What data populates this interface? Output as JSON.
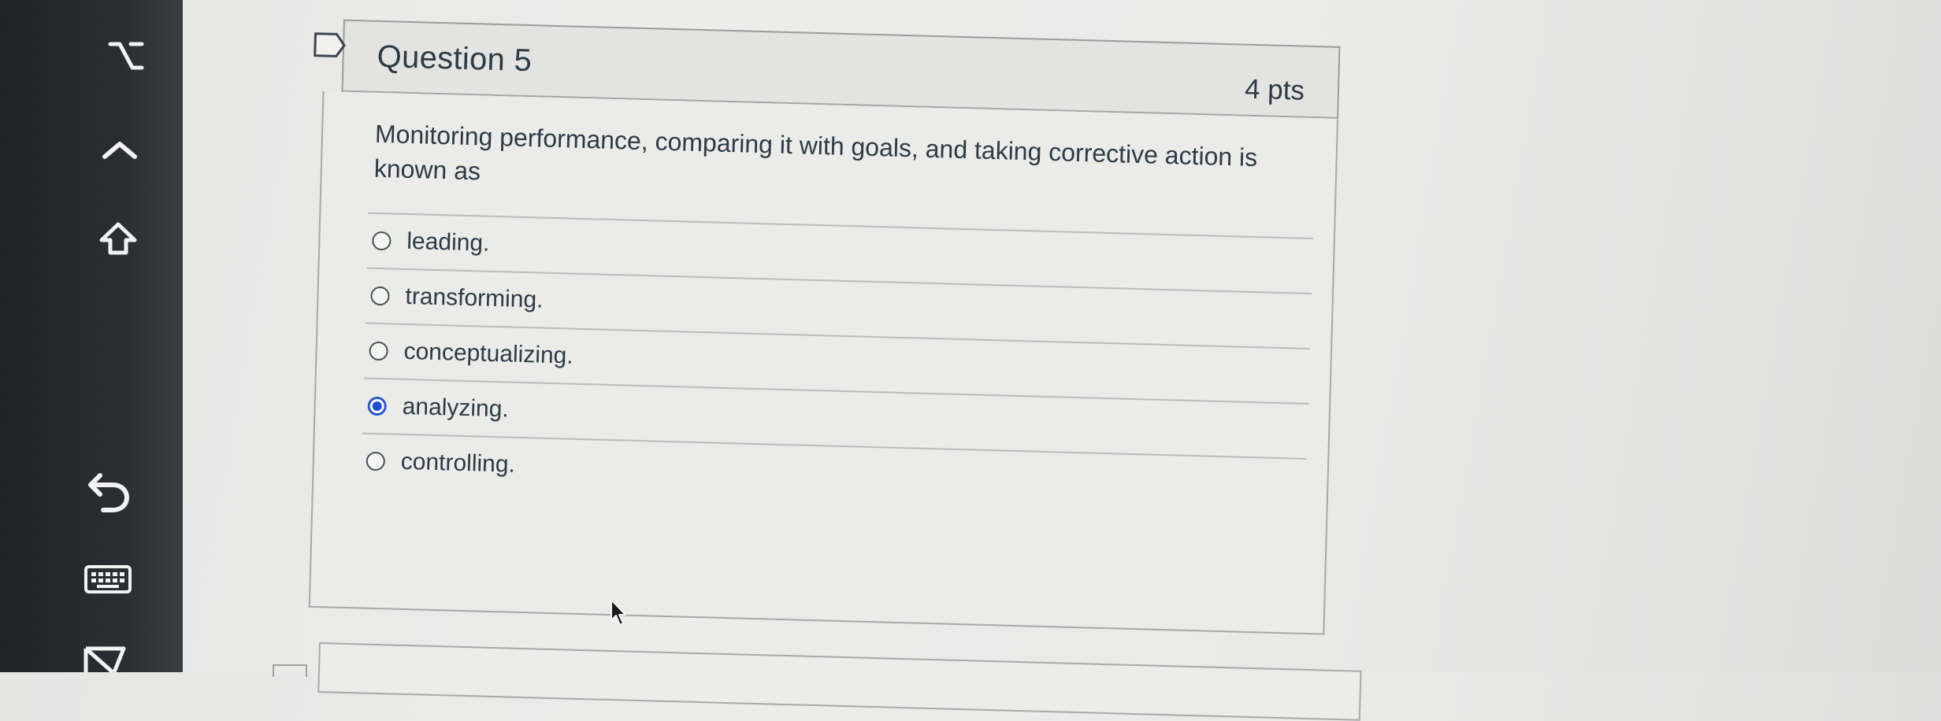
{
  "toolbar": {
    "items": [
      {
        "icon": "option-key-icon"
      },
      {
        "icon": "control-key-icon"
      },
      {
        "icon": "shift-key-icon"
      },
      {
        "icon": "undo-icon"
      },
      {
        "icon": "keyboard-icon"
      },
      {
        "icon": "hide-toolbar-icon"
      }
    ]
  },
  "question": {
    "title": "Question 5",
    "points": "4 pts",
    "prompt": "Monitoring performance, comparing it with goals, and taking corrective action is known as",
    "answers": [
      {
        "label": "leading.",
        "selected": false
      },
      {
        "label": "transforming.",
        "selected": false
      },
      {
        "label": "conceptualizing.",
        "selected": false
      },
      {
        "label": "analyzing.",
        "selected": true
      },
      {
        "label": "controlling.",
        "selected": false
      }
    ]
  },
  "colors": {
    "text": "#2d3b45",
    "selected_radio": "#1f4fd0",
    "toolbar_bg": "#26292d"
  }
}
